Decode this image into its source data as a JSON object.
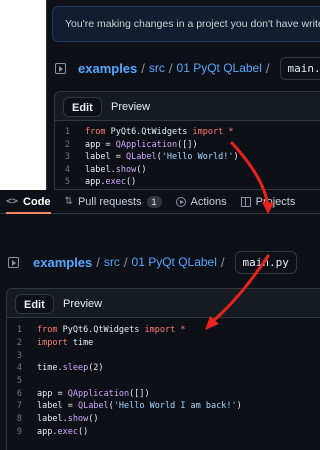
{
  "top": {
    "notice": "You're making changes in a project you don't have write access to.",
    "breadcrumb": {
      "repo": "examples",
      "sep1": "/",
      "src": "src",
      "sep2": "/",
      "folder": "01 PyQt QLabel",
      "sep3": "/",
      "filename": "main.py"
    },
    "tabs": {
      "edit": "Edit",
      "preview": "Preview"
    },
    "code": [
      {
        "n": "1",
        "parts": [
          [
            "kw",
            "from "
          ],
          [
            "plain",
            "PyQt6.QtWidgets "
          ],
          [
            "kw",
            "import "
          ],
          [
            "kw",
            "*"
          ]
        ]
      },
      {
        "n": "2",
        "parts": [
          [
            "plain",
            "app = "
          ],
          [
            "fn",
            "QApplication"
          ],
          [
            "plain",
            "([])"
          ]
        ]
      },
      {
        "n": "3",
        "parts": [
          [
            "plain",
            "label = "
          ],
          [
            "fn",
            "QLabel"
          ],
          [
            "plain",
            "("
          ],
          [
            "str",
            "'Hello World!'"
          ],
          [
            "plain",
            ")"
          ]
        ]
      },
      {
        "n": "4",
        "parts": [
          [
            "plain",
            "label."
          ],
          [
            "fn",
            "show"
          ],
          [
            "plain",
            "()"
          ]
        ]
      },
      {
        "n": "5",
        "parts": [
          [
            "plain",
            "app."
          ],
          [
            "fn",
            "exec"
          ],
          [
            "plain",
            "()"
          ]
        ]
      }
    ]
  },
  "bottom": {
    "nav": {
      "code": "Code",
      "pulls": "Pull requests",
      "pulls_count": "1",
      "actions": "Actions",
      "projects": "Projects"
    },
    "breadcrumb": {
      "repo": "examples",
      "sep1": "/",
      "src": "src",
      "sep2": "/",
      "folder": "01 PyQt QLabel",
      "sep3": "/",
      "filename": "main.py"
    },
    "tabs": {
      "edit": "Edit",
      "preview": "Preview"
    },
    "code": [
      {
        "n": "1",
        "parts": [
          [
            "kw",
            "from "
          ],
          [
            "plain",
            "PyQt6.QtWidgets "
          ],
          [
            "kw",
            "import "
          ],
          [
            "kw",
            "*"
          ]
        ]
      },
      {
        "n": "2",
        "parts": [
          [
            "kw",
            "import "
          ],
          [
            "plain",
            "time"
          ]
        ]
      },
      {
        "n": "3",
        "parts": []
      },
      {
        "n": "4",
        "parts": [
          [
            "plain",
            "time."
          ],
          [
            "fn",
            "sleep"
          ],
          [
            "plain",
            "(2)"
          ]
        ]
      },
      {
        "n": "5",
        "parts": []
      },
      {
        "n": "6",
        "parts": [
          [
            "plain",
            "app = "
          ],
          [
            "fn",
            "QApplication"
          ],
          [
            "plain",
            "([])"
          ]
        ]
      },
      {
        "n": "7",
        "parts": [
          [
            "plain",
            "label = "
          ],
          [
            "fn",
            "QLabel"
          ],
          [
            "plain",
            "("
          ],
          [
            "str",
            "'Hello World I am back!'"
          ],
          [
            "plain",
            ")"
          ]
        ]
      },
      {
        "n": "8",
        "parts": [
          [
            "plain",
            "label."
          ],
          [
            "fn",
            "show"
          ],
          [
            "plain",
            "()"
          ]
        ]
      },
      {
        "n": "9",
        "parts": [
          [
            "plain",
            "app."
          ],
          [
            "fn",
            "exec"
          ],
          [
            "plain",
            "()"
          ]
        ]
      }
    ]
  },
  "colors": {
    "annotation_arrow": "#e8231d",
    "background": "#0d1117",
    "link": "#58a6ff"
  }
}
